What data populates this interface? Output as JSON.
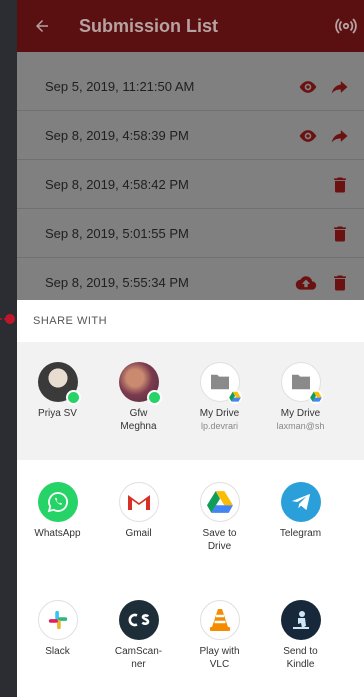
{
  "appbar": {
    "title": "Submission List"
  },
  "submissions": [
    {
      "date": "Sep 5, 2019, 11:21:50 AM",
      "actions": [
        "eye-icon",
        "share-arrow-icon"
      ]
    },
    {
      "date": "Sep 8, 2019, 4:58:39 PM",
      "actions": [
        "eye-icon",
        "share-arrow-icon"
      ]
    },
    {
      "date": "Sep 8, 2019, 4:58:42 PM",
      "actions": [
        "trash-icon"
      ]
    },
    {
      "date": "Sep 8, 2019, 5:01:55 PM",
      "actions": [
        "trash-icon"
      ]
    },
    {
      "date": "Sep 8, 2019, 5:55:34 PM",
      "actions": [
        "cloud-upload-icon",
        "trash-icon"
      ]
    }
  ],
  "share_sheet": {
    "header": "SHARE WITH",
    "direct_targets": [
      {
        "label": "Priya SV",
        "sub": ""
      },
      {
        "label": "Gfw\nMeghna",
        "sub": ""
      },
      {
        "label": "My Drive",
        "sub": "lp.devrari"
      },
      {
        "label": "My Drive",
        "sub": "laxman@sh"
      }
    ],
    "apps_row1": [
      {
        "label": "WhatsApp"
      },
      {
        "label": "Gmail"
      },
      {
        "label": "Save to\nDrive"
      },
      {
        "label": "Telegram"
      }
    ],
    "apps_row2": [
      {
        "label": "Slack"
      },
      {
        "label": "CamScan-\nner"
      },
      {
        "label": "Play with\nVLC"
      },
      {
        "label": "Send to\nKindle"
      }
    ]
  },
  "colors": {
    "appbar": "#5a0f10",
    "accent_red": "#7a1717",
    "overlay": "#808080",
    "pointer": "#c0162b"
  }
}
